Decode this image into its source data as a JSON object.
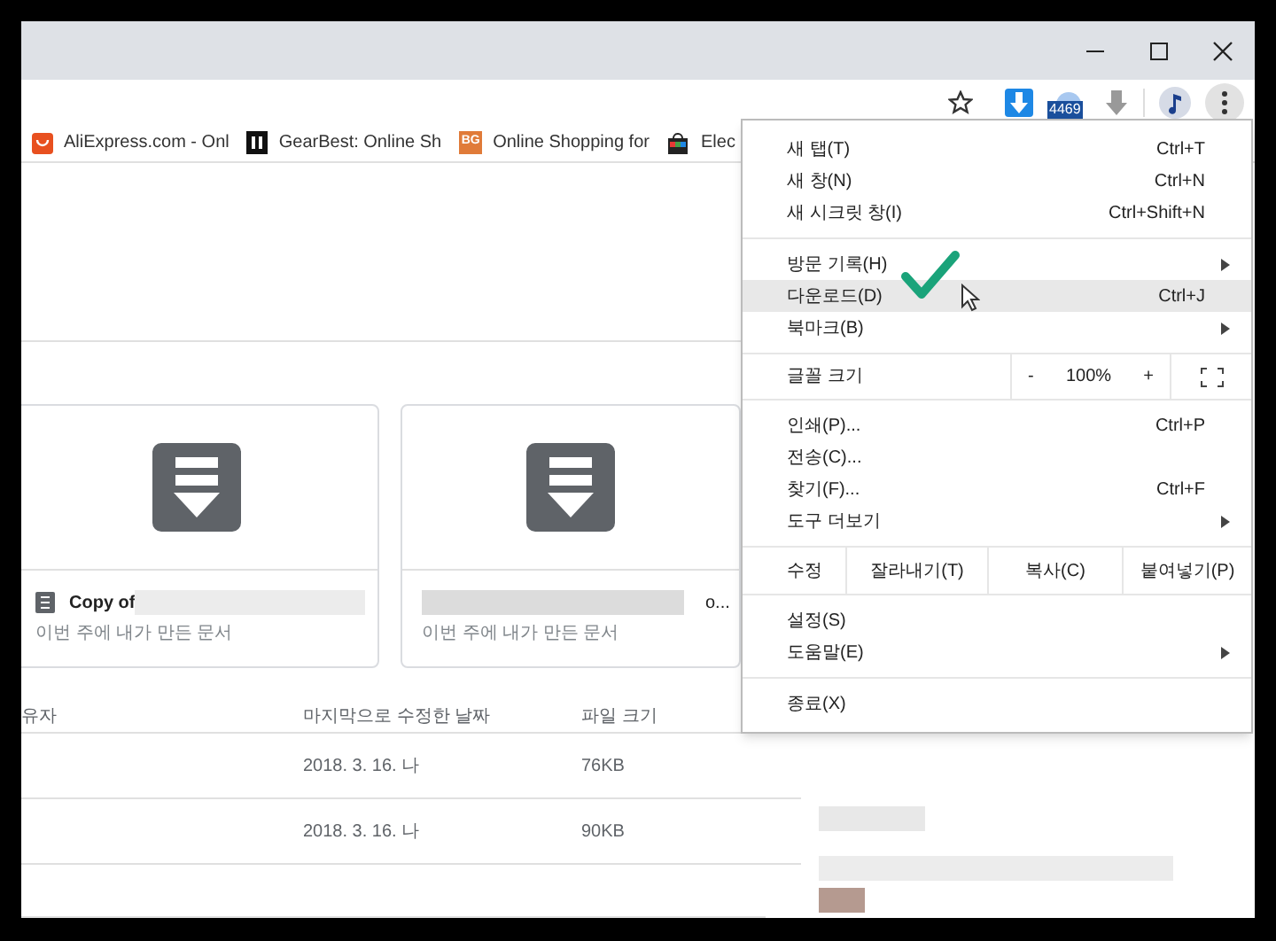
{
  "toolbar": {
    "extension_badge": "4469"
  },
  "bookmarks": [
    {
      "label": "AliExpress.com - Onl",
      "kind": "bag"
    },
    {
      "label": "GearBest: Online Sh",
      "kind": "dark"
    },
    {
      "label": "Online Shopping for",
      "kind": "letters",
      "icon_text": "BG"
    },
    {
      "label": "Elec",
      "kind": "shop"
    }
  ],
  "cards": [
    {
      "title_prefix": "Copy of",
      "subtitle": "이번 주에 내가 만든 문서"
    },
    {
      "title_suffix": "o...",
      "subtitle": "이번 주에 내가 만든 문서"
    }
  ],
  "table": {
    "columns": [
      "유자",
      "마지막으로 수정한 날짜",
      "파일 크기"
    ],
    "rows": [
      [
        "",
        "2018. 3. 16. 나",
        "76KB"
      ],
      [
        "",
        "2018. 3. 16. 나",
        "90KB"
      ]
    ]
  },
  "menu": {
    "items": [
      {
        "kind": "item",
        "label": "새 탭(T)",
        "shortcut": "Ctrl+T",
        "submenu": false,
        "selected": false
      },
      {
        "kind": "item",
        "label": "새 창(N)",
        "shortcut": "Ctrl+N",
        "submenu": false,
        "selected": false
      },
      {
        "kind": "item",
        "label": "새 시크릿 창(I)",
        "shortcut": "Ctrl+Shift+N",
        "submenu": false,
        "selected": false
      },
      {
        "kind": "separator"
      },
      {
        "kind": "item",
        "label": "방문 기록(H)",
        "submenu": true,
        "selected": false
      },
      {
        "kind": "item",
        "label": "다운로드(D)",
        "shortcut": "Ctrl+J",
        "submenu": false,
        "selected": true
      },
      {
        "kind": "item",
        "label": "북마크(B)",
        "submenu": true,
        "selected": false
      },
      {
        "kind": "zoom",
        "label": "글꼴 크기",
        "minus": "-",
        "value": "100%",
        "plus": "+"
      },
      {
        "kind": "item",
        "label": "인쇄(P)...",
        "shortcut": "Ctrl+P",
        "submenu": false,
        "selected": false
      },
      {
        "kind": "item",
        "label": "전송(C)...",
        "submenu": false,
        "selected": false
      },
      {
        "kind": "item",
        "label": "찾기(F)...",
        "shortcut": "Ctrl+F",
        "submenu": false,
        "selected": false
      },
      {
        "kind": "item",
        "label": "도구 더보기",
        "submenu": true,
        "selected": false
      },
      {
        "kind": "edit",
        "label": "수정",
        "buttons": [
          "잘라내기(T)",
          "복사(C)",
          "붙여넣기(P)"
        ]
      },
      {
        "kind": "item",
        "label": "설정(S)",
        "submenu": false,
        "selected": false
      },
      {
        "kind": "item",
        "label": "도움말(E)",
        "submenu": true,
        "selected": false
      },
      {
        "kind": "separator"
      },
      {
        "kind": "item",
        "label": "종료(X)",
        "submenu": false,
        "selected": false
      }
    ]
  }
}
